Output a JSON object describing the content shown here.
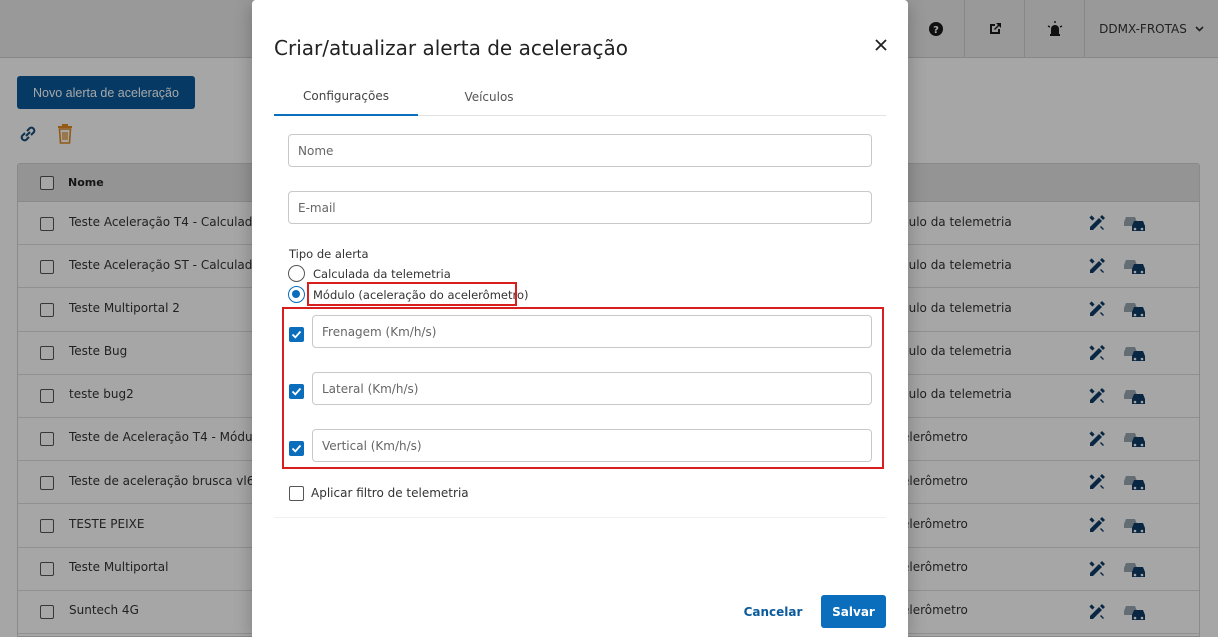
{
  "header": {
    "user_name": "DDMX-FROTAS"
  },
  "page": {
    "new_alert_label": "Novo alerta de aceleração",
    "table": {
      "name_header": "Nome",
      "rows": [
        {
          "name": "Teste Aceleração T4 - Calculada",
          "type": "culo da telemetria"
        },
        {
          "name": "Teste Aceleração ST - Calculada",
          "type": "culo da telemetria"
        },
        {
          "name": "Teste Multiportal 2",
          "type": "culo da telemetria"
        },
        {
          "name": "Teste Bug",
          "type": "culo da telemetria"
        },
        {
          "name": "teste bug2",
          "type": "culo da telemetria"
        },
        {
          "name": "Teste de Aceleração T4 - Módulo",
          "type": "elerômetro"
        },
        {
          "name": "Teste de aceleração brusca vl6",
          "type": "elerômetro"
        },
        {
          "name": "TESTE PEIXE",
          "type": "elerômetro"
        },
        {
          "name": "Teste Multiportal",
          "type": "elerômetro"
        },
        {
          "name": "Suntech 4G",
          "type": "elerômetro"
        }
      ]
    }
  },
  "modal": {
    "title": "Criar/atualizar alerta de aceleração",
    "tabs": [
      {
        "label": "Configurações",
        "active": true
      },
      {
        "label": "Veículos",
        "active": false
      }
    ],
    "name_placeholder": "Nome",
    "email_placeholder": "E-mail",
    "alert_type_label": "Tipo de alerta",
    "alert_type_options": [
      {
        "label": "Calculada da telemetria",
        "selected": false
      },
      {
        "label": "Módulo (aceleração do acelerômetro)",
        "selected": true
      }
    ],
    "thresholds": [
      {
        "placeholder": "Frenagem (Km/h/s)",
        "checked": true
      },
      {
        "placeholder": "Lateral (Km/h/s)",
        "checked": true
      },
      {
        "placeholder": "Vertical (Km/h/s)",
        "checked": true
      }
    ],
    "telemetry_filter_label": "Aplicar filtro de telemetria",
    "cancel_label": "Cancelar",
    "save_label": "Salvar"
  },
  "colors": {
    "primary": "#0a6ebd",
    "primary_dark": "#0a5a9c",
    "highlight": "#d81e1e",
    "trash_icon": "#e08a1e",
    "row_icon": "#0f3b66"
  }
}
